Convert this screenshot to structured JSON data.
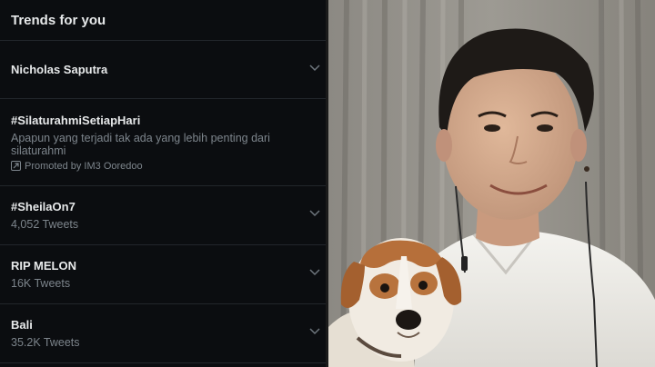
{
  "trends": {
    "title": "Trends for you",
    "items": [
      {
        "name": "Nicholas Saputra"
      },
      {
        "name": "#SilaturahmiSetiapHari",
        "description": "Apapun yang terjadi tak ada yang lebih penting dari silaturahmi",
        "promoted": "Promoted by IM3 Ooredoo"
      },
      {
        "name": "#SheilaOn7",
        "count": "4,052 Tweets"
      },
      {
        "name": "RIP MELON",
        "count": "16K Tweets"
      },
      {
        "name": "Bali",
        "count": "35.2K Tweets"
      }
    ]
  },
  "colors": {
    "panel_bg": "#0b0d10",
    "text_primary": "#e7e9ea",
    "text_secondary": "#7d858c",
    "divider": "#22262b"
  },
  "icons": {
    "more": "chevron-down-icon",
    "promoted": "promoted-arrow-icon"
  }
}
